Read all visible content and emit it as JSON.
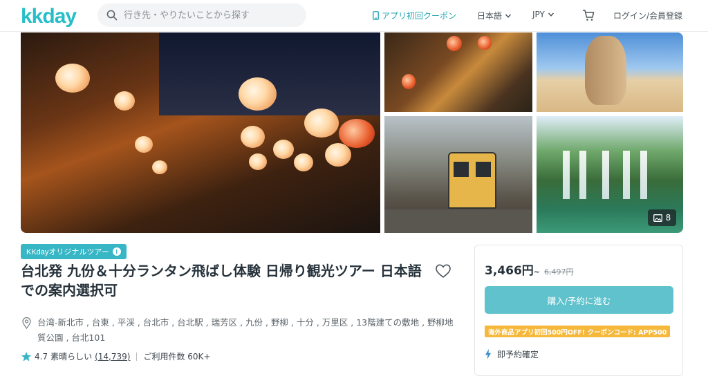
{
  "header": {
    "logo": "KKday",
    "search_placeholder": "行き先・やりたいことから探す",
    "coupon_link": "アプリ初回クーポン",
    "language": "日本語",
    "currency": "JPY",
    "login": "ログイン/会員登録"
  },
  "gallery": {
    "photo_count": "8"
  },
  "product": {
    "badge": "KKdayオリジナルツアー",
    "title": "台北発 九份＆十分ランタン飛ばし体験 日帰り観光ツアー 日本語での案内選択可",
    "locations": "台湾-新北市 , 台東 , 平渓 , 台北市 , 台北駅 , 瑞芳区 , 九份 , 野柳 , 十分 , 万里区 , 13階建ての敷地 , 野柳地質公園 , 台北101",
    "rating_value": "4.7",
    "rating_text": "素晴らしい",
    "review_count": "(14,739)",
    "usage_label": "ご利用件数 60K+"
  },
  "booking": {
    "price": "3,466円",
    "price_suffix": "~",
    "original_price": "6,497円",
    "book_button": "購入/予約に進む",
    "promo": "海外商品アプリ初回500円OFF! クーポンコード: APP500",
    "instant_confirm": "即予約確定"
  },
  "colors": {
    "brand": "#26bec9",
    "button": "#5fc2cc",
    "promo": "#f5b83a",
    "star": "#37b6c5"
  },
  "icons": [
    "search-icon",
    "phone-icon",
    "chevron-down-icon",
    "cart-icon",
    "image-icon",
    "info-icon",
    "heart-icon",
    "location-pin-icon",
    "star-icon",
    "lightning-icon"
  ]
}
